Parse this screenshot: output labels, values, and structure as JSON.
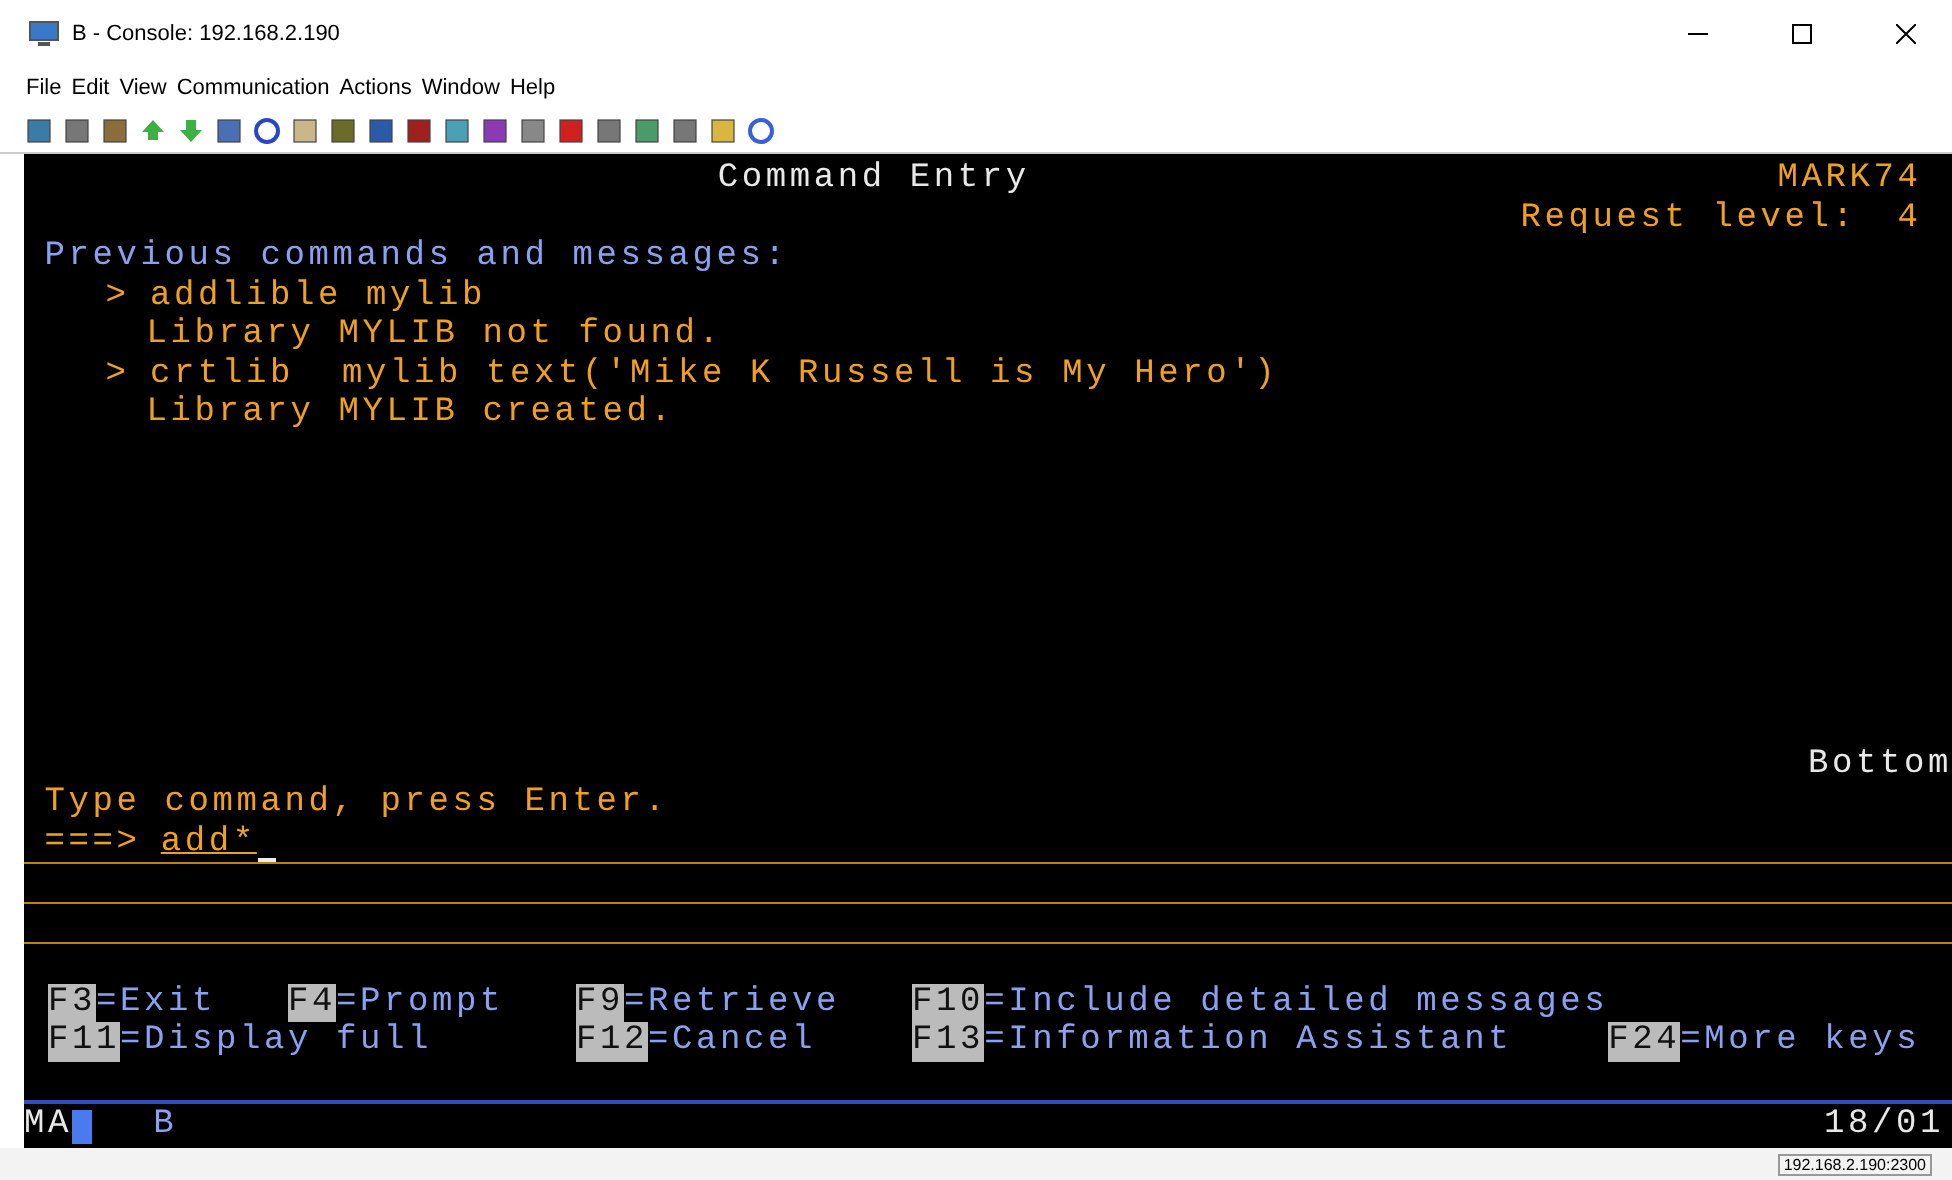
{
  "window": {
    "title": "B - Console: 192.168.2.190"
  },
  "menu": [
    "File",
    "Edit",
    "View",
    "Communication",
    "Actions",
    "Window",
    "Help"
  ],
  "screen": {
    "title": "Command Entry",
    "system": "MARK74",
    "request_level_label": "Request level:",
    "request_level": "4",
    "section_title": "Previous commands and messages:",
    "messages": [
      {
        "kind": "command",
        "prompt": ">",
        "text": "addlible mylib"
      },
      {
        "kind": "message",
        "text": "Library MYLIB not found."
      },
      {
        "kind": "command",
        "prompt": ">",
        "text": "crtlib  mylib text('Mike K Russell is My Hero')"
      },
      {
        "kind": "message",
        "text": "Library MYLIB created."
      }
    ],
    "more": "Bottom",
    "instruction": "Type command, press Enter.",
    "prompt": "===>",
    "command": {
      "value": "add*"
    },
    "function_keys": [
      [
        {
          "key": "F3",
          "label": "=Exit"
        },
        {
          "key": "F4",
          "label": "=Prompt"
        },
        {
          "key": "F9",
          "label": "=Retrieve"
        },
        {
          "key": "F10",
          "label": "=Include detailed messages"
        }
      ],
      [
        {
          "key": "F11",
          "label": "=Display full"
        },
        {
          "key": "F12",
          "label": "=Cancel"
        },
        {
          "key": "F13",
          "label": "=Information Assistant"
        },
        {
          "key": "F24",
          "label": "=More keys"
        }
      ]
    ]
  },
  "oia": {
    "left": "MA",
    "session": "B",
    "position": "18/01"
  },
  "status_bar": {
    "address": "192.168.2.190:2300"
  }
}
